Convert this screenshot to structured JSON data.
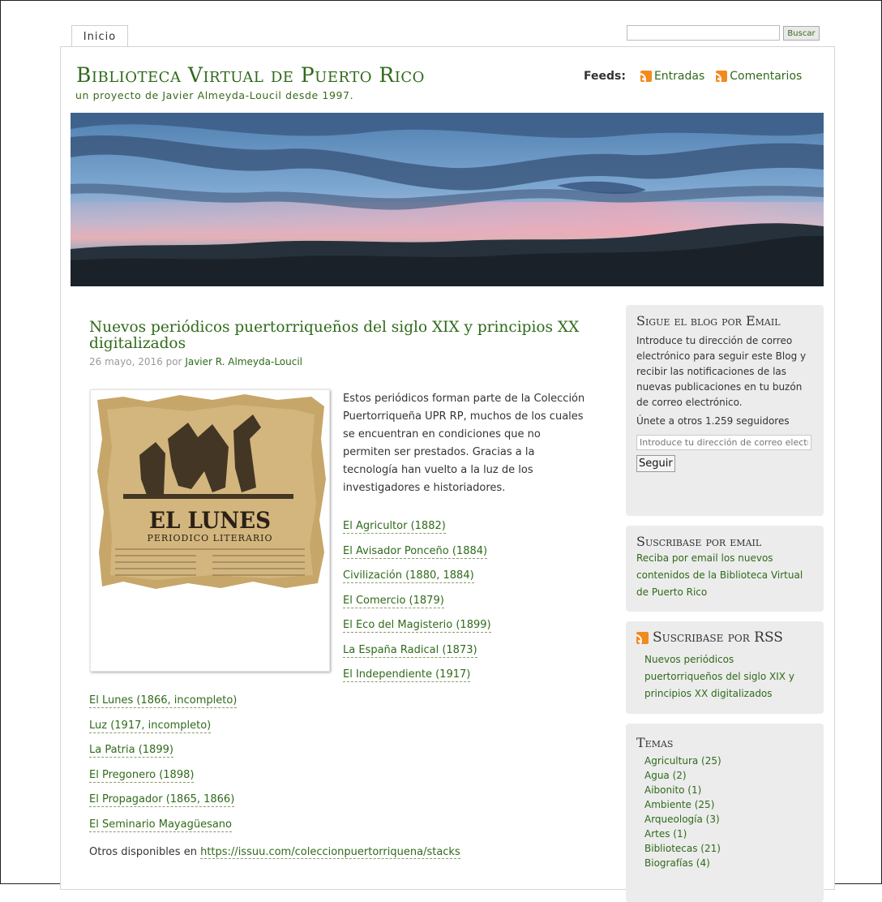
{
  "nav": {
    "home_tab": "Inicio"
  },
  "search": {
    "placeholder": "",
    "button_label": "Buscar"
  },
  "header": {
    "site_title": "Biblioteca Virtual de Puerto Rico",
    "tagline": "un proyecto de Javier Almeyda-Loucil desde 1997.",
    "feeds_label": "Feeds:",
    "feed_entries": "Entradas",
    "feed_comments": "Comentarios"
  },
  "post": {
    "title": "Nuevos periódicos puertorriqueños del siglo XIX y principios XX digitalizados",
    "date": "26 mayo, 2016",
    "by": "por",
    "author": "Javier R. Almeyda-Loucil",
    "image_masthead": "EL LUNES",
    "image_subtitle": "PERIODICO LITERARIO",
    "intro": "Estos periódicos forman parte de la Colección Puertorriqueña UPR RP, muchos de los cuales se encuentran en condiciones que no permiten ser prestados. Gracias a la tecnología han vuelto a la luz de los investigadores e historiadores.",
    "links_right": [
      "El Agricultor (1882)",
      "El Avisador Ponceño (1884)",
      "Civilización (1880, 1884)",
      "El Comercio (1879)",
      "El Eco del Magisterio (1899)",
      "La España Radical (1873)",
      "El Independiente (1917)"
    ],
    "links_left": [
      "El Lunes (1866, incompleto)",
      "Luz (1917, incompleto)",
      "La Patria (1899)",
      "El Pregonero (1898)",
      "El Propagador (1865, 1866)",
      "El Seminario Mayagüesano"
    ],
    "more_prefix": "Otros disponibles en",
    "more_link": "https://issuu.com/coleccionpuertorriquena/stacks"
  },
  "sidebar": {
    "email_widget": {
      "title": "Sigue el blog por Email",
      "description": "Introduce tu dirección de correo electrónico para seguir este Blog y recibir las notificaciones de las nuevas publicaciones en tu buzón de correo electrónico.",
      "followers": "Únete a otros 1.259 seguidores",
      "input_placeholder": "Introduce tu dirección de correo electrónico",
      "button_label": "Seguir"
    },
    "suscribe_email": {
      "title": "Suscribase por email",
      "link": "Reciba por email los nuevos contenidos de la Biblioteca Virtual de Puerto Rico"
    },
    "suscribe_rss": {
      "title": "Suscribase por RSS",
      "items": [
        "Nuevos periódicos puertorriqueños del siglo XIX y principios XX digitalizados"
      ]
    },
    "temas": {
      "title": "Temas",
      "items": [
        "Agricultura (25)",
        "Agua (2)",
        "Aibonito (1)",
        "Ambiente (25)",
        "Arqueología (3)",
        "Artes (1)",
        "Bibliotecas (21)",
        "Biografías (4)"
      ]
    }
  },
  "colors": {
    "accent": "#2f6a1a",
    "rss": "#f38a1e",
    "widget_bg": "#ececec"
  }
}
